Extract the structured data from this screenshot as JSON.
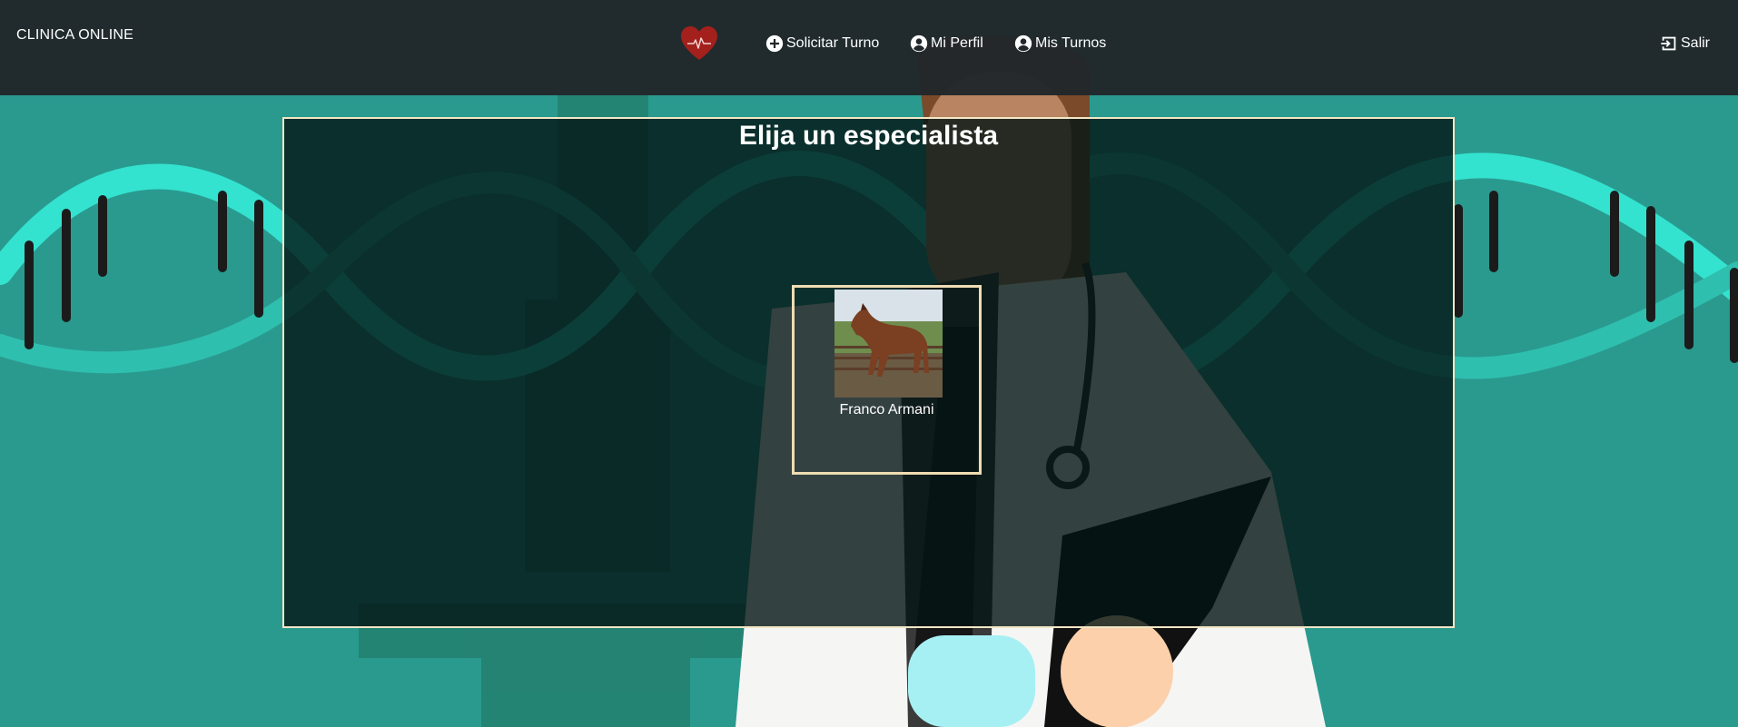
{
  "navbar": {
    "brand": "CLINICA ONLINE",
    "logo_icon": "heart-pulse-icon",
    "items": [
      {
        "label": "Solicitar Turno",
        "icon": "plus-circle-icon"
      },
      {
        "label": "Mi Perfil",
        "icon": "account-circle-icon"
      },
      {
        "label": "Mis Turnos",
        "icon": "account-circle-icon"
      }
    ],
    "logout": {
      "label": "Salir",
      "icon": "logout-icon"
    }
  },
  "main": {
    "title": "Elija un especialista",
    "specialists": [
      {
        "name": "Franco Armani",
        "photo": "horse-photo"
      }
    ]
  },
  "colors": {
    "background": "#2a9a8f",
    "navbar": "#21272a",
    "panel_border": "#f2e7c6",
    "card_border": "#efdcb3",
    "logo": "#a3201c"
  }
}
